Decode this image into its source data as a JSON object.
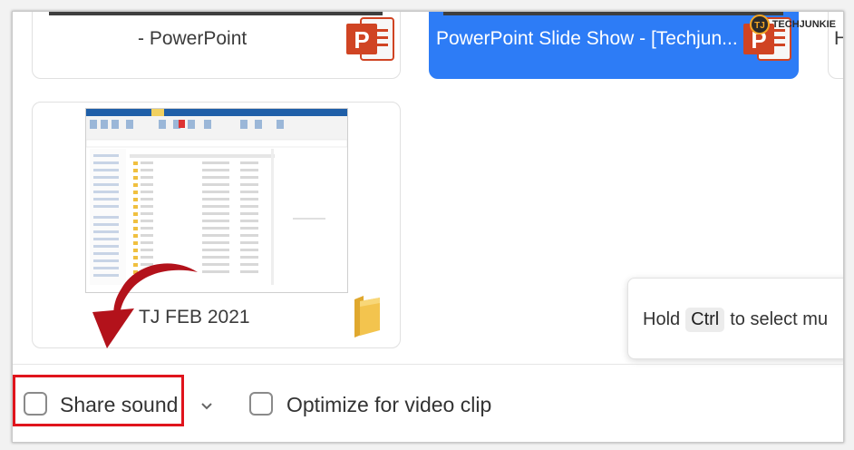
{
  "windows": [
    {
      "title": "- PowerPoint",
      "icon": "powerpoint-icon",
      "selected": false
    },
    {
      "title": "PowerPoint Slide Show - [Techjun...",
      "icon": "powerpoint-icon",
      "selected": true
    },
    {
      "title": "TJ FEB 2021",
      "icon": "folder-icon",
      "selected": false
    }
  ],
  "tooltip": {
    "prefix": "Hold",
    "key": "Ctrl",
    "suffix": "to select mu"
  },
  "options": {
    "share_sound": "Share sound",
    "optimize": "Optimize for video clip"
  },
  "logo": {
    "text": "TECHJUNKIE",
    "badge": "TJ"
  },
  "colors": {
    "selected": "#2d7cf6",
    "powerpoint": "#d04423",
    "highlight": "#e0141c",
    "arrow": "#b3121b",
    "folder": "#f3c44e"
  }
}
